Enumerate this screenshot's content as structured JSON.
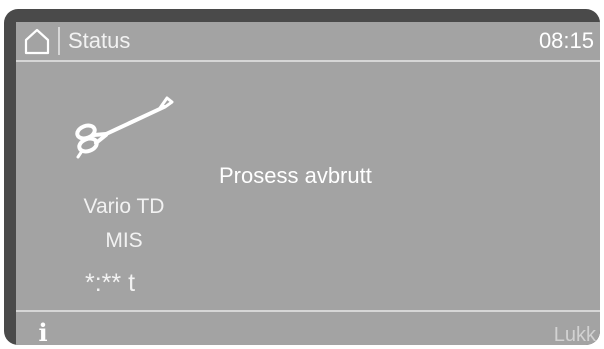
{
  "header": {
    "home_icon": "home-icon",
    "title": "Status",
    "time": "08:15"
  },
  "program": {
    "icon": "surgical-instrument-icon",
    "name": "Vario TD",
    "sub": "MIS",
    "time_remaining": "*:** t"
  },
  "main": {
    "status_message": "Prosess avbrutt"
  },
  "footer": {
    "info_icon": "info-icon",
    "info_label": "i",
    "close_label": "Lukk"
  },
  "colors": {
    "display_bg": "#a3a3a3",
    "bezel": "#4a4a4a",
    "text": "#ffffff"
  }
}
